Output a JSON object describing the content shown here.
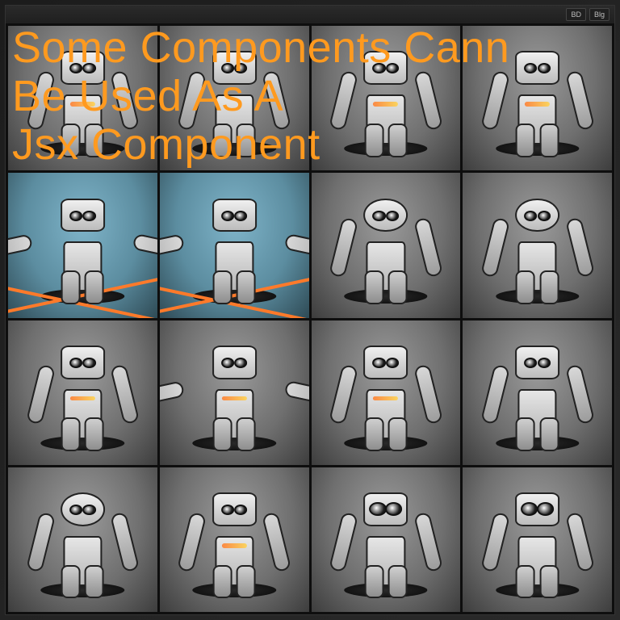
{
  "headline_line1": "Some Components Cann",
  "headline_line2": "Be Used As A",
  "headline_line3": "Jsx Component",
  "toolbar": {
    "btn1": "BD",
    "btn2": "Blg"
  },
  "grid": {
    "rows": 4,
    "cols": 4
  },
  "cells": [
    {
      "variant": "",
      "spread": false,
      "stripe": true,
      "bigeye": false
    },
    {
      "variant": "",
      "spread": false,
      "stripe": false,
      "bigeye": false
    },
    {
      "variant": "",
      "spread": false,
      "stripe": true,
      "bigeye": false
    },
    {
      "variant": "",
      "spread": false,
      "stripe": true,
      "bigeye": false
    },
    {
      "variant": "blue",
      "spread": true,
      "stripe": false,
      "bigeye": false,
      "beams": true
    },
    {
      "variant": "blue",
      "spread": true,
      "stripe": false,
      "bigeye": false,
      "beams": true
    },
    {
      "variant": "",
      "spread": false,
      "stripe": false,
      "bigeye": false,
      "mono": true
    },
    {
      "variant": "",
      "spread": false,
      "stripe": false,
      "bigeye": false,
      "mono": true
    },
    {
      "variant": "",
      "spread": false,
      "stripe": true,
      "bigeye": false
    },
    {
      "variant": "",
      "spread": true,
      "stripe": true,
      "bigeye": false
    },
    {
      "variant": "",
      "spread": false,
      "stripe": true,
      "bigeye": false
    },
    {
      "variant": "",
      "spread": false,
      "stripe": false,
      "bigeye": false
    },
    {
      "variant": "",
      "spread": false,
      "stripe": false,
      "bigeye": false,
      "mono": true
    },
    {
      "variant": "",
      "spread": false,
      "stripe": true,
      "bigeye": false
    },
    {
      "variant": "",
      "spread": false,
      "stripe": false,
      "bigeye": true
    },
    {
      "variant": "",
      "spread": false,
      "stripe": false,
      "bigeye": true
    }
  ]
}
